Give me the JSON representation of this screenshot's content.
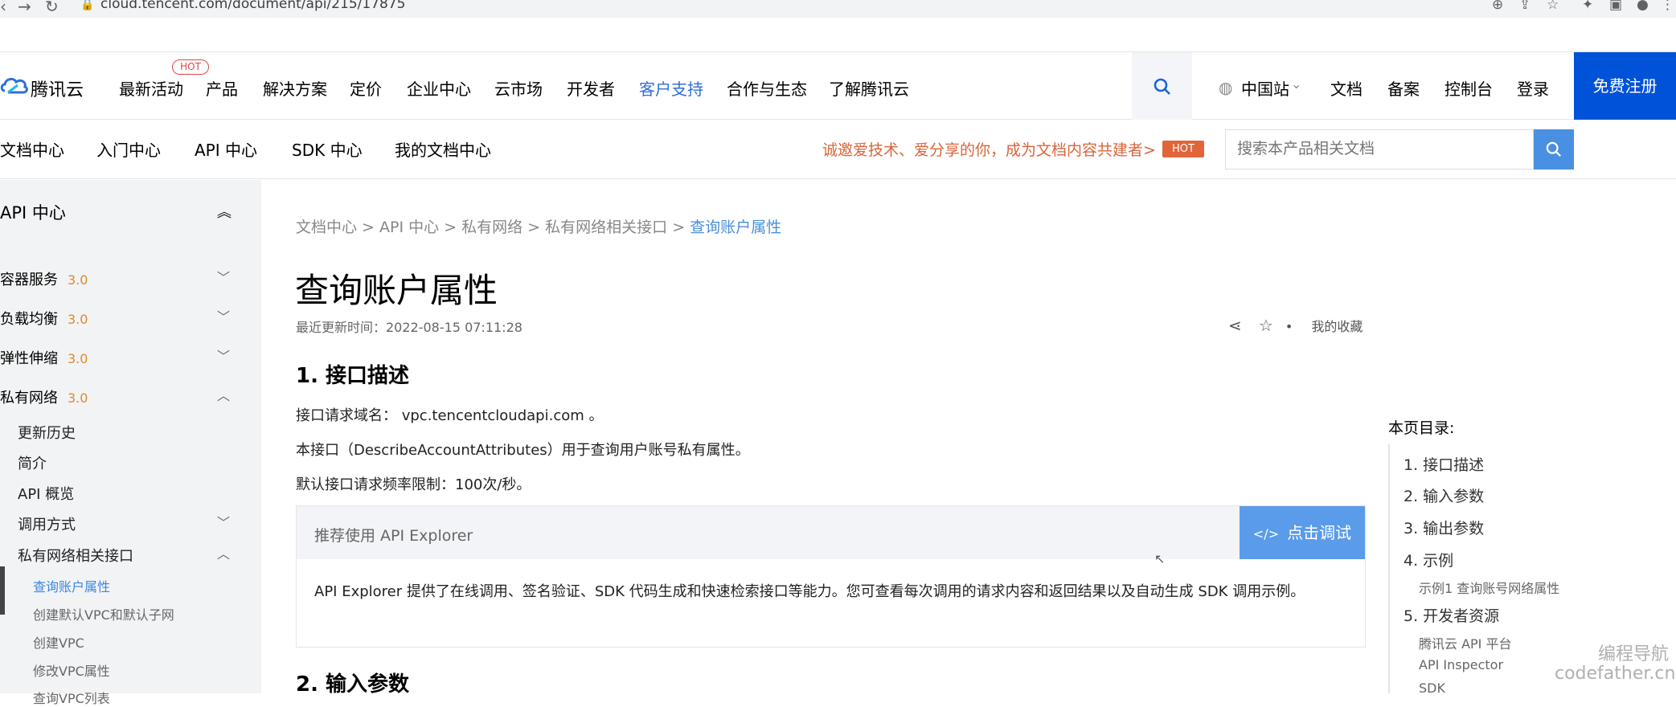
{
  "browser": {
    "url": "cloud.tencent.com/document/api/215/17875"
  },
  "topnav": {
    "brand": "腾讯云",
    "hot_badge": "HOT",
    "items": [
      "最新活动",
      "产品",
      "解决方案",
      "定价",
      "企业中心",
      "云市场",
      "开发者",
      "客户支持",
      "合作与生态",
      "了解腾讯云"
    ],
    "active_item": "客户支持",
    "region": "中国站",
    "right_links": [
      "文档",
      "备案",
      "控制台",
      "登录"
    ],
    "register": "免费注册",
    "accent": "#0052d9"
  },
  "subnav": {
    "items": [
      "文档中心",
      "入门中心",
      "API 中心",
      "SDK 中心",
      "我的文档中心"
    ],
    "promo": "诚邀爱技术、爱分享的你，成为文档内容共建者>",
    "promo_hot": "HOT",
    "search_placeholder": "搜索本产品相关文档"
  },
  "sidebar": {
    "title": "API 中心",
    "sections": [
      {
        "label": "容器服务",
        "version": "3.0"
      },
      {
        "label": "负载均衡",
        "version": "3.0"
      },
      {
        "label": "弹性伸缩",
        "version": "3.0"
      },
      {
        "label": "私有网络",
        "version": "3.0"
      }
    ],
    "sub_items": [
      "更新历史",
      "简介",
      "API 概览",
      "调用方式",
      "私有网络相关接口"
    ],
    "leaf_items": [
      "查询账户属性",
      "创建默认VPC和默认子网",
      "创建VPC",
      "修改VPC属性",
      "查询VPC列表"
    ]
  },
  "content": {
    "breadcrumb": [
      "文档中心",
      "API 中心",
      "私有网络",
      "私有网络相关接口",
      "查询账户属性"
    ],
    "title": "查询账户属性",
    "update_time": "最近更新时间：2022-08-15 07:11:28",
    "favorites": "我的收藏",
    "sec1": "1. 接口描述",
    "domain_line": "接口请求域名： vpc.tencentcloudapi.com 。",
    "desc_line": "本接口（DescribeAccountAttributes）用于查询用户账号私有属性。",
    "rate_line": "默认接口请求频率限制：100次/秒。",
    "explorer_label": "推荐使用 API Explorer",
    "debug_button": "点击调试",
    "explorer_desc": "API Explorer 提供了在线调用、签名验证、SDK 代码生成和快速检索接口等能力。您可查看每次调用的请求内容和返回结果以及自动生成 SDK 调用示例。",
    "sec2": "2. 输入参数"
  },
  "toc": {
    "title": "本页目录:",
    "items": [
      "1. 接口描述",
      "2. 输入参数",
      "3. 输出参数",
      "4. 示例",
      "示例1 查询账号网络属性",
      "5. 开发者资源",
      "腾讯云 API 平台",
      "API Inspector",
      "SDK"
    ]
  },
  "watermark": {
    "line1": "编程导航",
    "line2": "codefather.cn"
  }
}
